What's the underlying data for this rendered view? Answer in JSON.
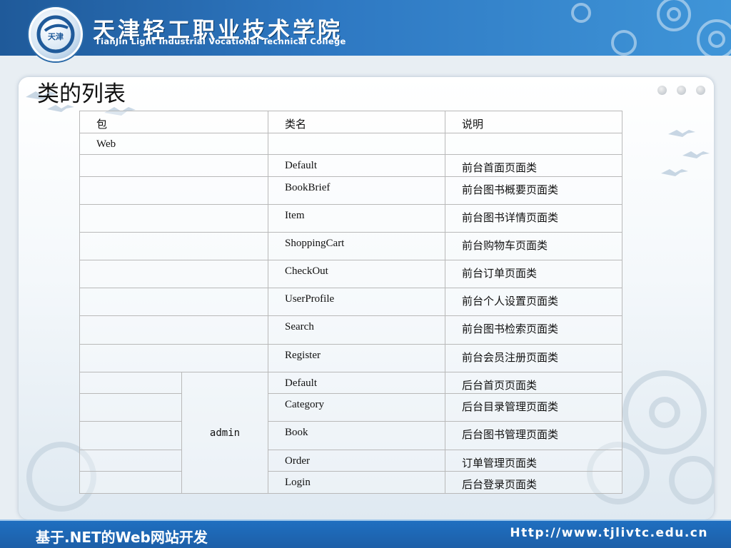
{
  "header": {
    "college_cn": "天津轻工职业技术学院",
    "college_en": "TianJin Light Industrial Vocational Technical College",
    "logo_text": "天津"
  },
  "slide": {
    "title": "类的列表"
  },
  "table": {
    "headers": [
      "包",
      "类名",
      "说明"
    ],
    "package_web": "Web",
    "package_admin": "admin",
    "rows": [
      {
        "class_name": "Default",
        "description": "前台首面页面类"
      },
      {
        "class_name": "BookBrief",
        "description": "前台图书概要页面类"
      },
      {
        "class_name": "Item",
        "description": "前台图书详情页面类"
      },
      {
        "class_name": "ShoppingCart",
        "description": "前台购物车页面类"
      },
      {
        "class_name": "CheckOut",
        "description": "前台订单页面类"
      },
      {
        "class_name": "UserProfile",
        "description": "前台个人设置页面类"
      },
      {
        "class_name": "Search",
        "description": "前台图书检索页面类"
      },
      {
        "class_name": "Register",
        "description": "前台会员注册页面类"
      },
      {
        "class_name": "Default",
        "description": "后台首页页面类"
      },
      {
        "class_name": "Category",
        "description": "后台目录管理页面类"
      },
      {
        "class_name": "Book",
        "description": "后台图书管理页面类"
      },
      {
        "class_name": "Order",
        "description": "订单管理页面类"
      },
      {
        "class_name": "Login",
        "description": "后台登录页面类"
      }
    ]
  },
  "footer": {
    "course_title": "基于.NET的Web网站开发",
    "url": "Http://www.tjlivtc.edu.cn"
  },
  "colors": {
    "banner_blue": "#2e78c2",
    "footer_blue": "#1d5fa8",
    "table_border": "#b9b9b9"
  }
}
